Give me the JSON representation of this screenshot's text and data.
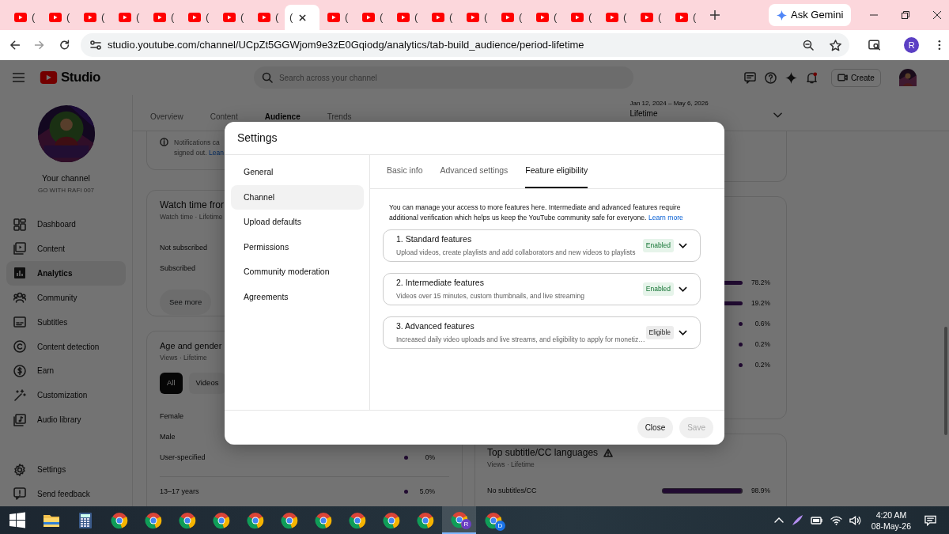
{
  "browser": {
    "tabs": [
      {
        "label": "(",
        "selected": false
      },
      {
        "label": "(",
        "selected": false
      },
      {
        "label": "(",
        "selected": false
      },
      {
        "label": "(",
        "selected": false
      },
      {
        "label": "(",
        "selected": false
      },
      {
        "label": "(",
        "selected": false
      },
      {
        "label": "(",
        "selected": false
      },
      {
        "label": "(",
        "selected": false
      },
      {
        "label": "(",
        "selected": true
      },
      {
        "label": "(",
        "selected": false
      },
      {
        "label": "(",
        "selected": false
      },
      {
        "label": "(",
        "selected": false
      },
      {
        "label": "(",
        "selected": false
      },
      {
        "label": "(",
        "selected": false
      },
      {
        "label": "(",
        "selected": false
      },
      {
        "label": "(",
        "selected": false
      },
      {
        "label": "(",
        "selected": false
      },
      {
        "label": "(",
        "selected": false
      },
      {
        "label": "(",
        "selected": false
      },
      {
        "label": "(",
        "selected": false
      }
    ],
    "gemini": "Ask Gemini",
    "url": "studio.youtube.com/channel/UCpZt5GGWjom9e3zE0Gqiodg/analytics/tab-build_audience/period-lifetime",
    "profile": "R"
  },
  "header": {
    "logo": "Studio",
    "search_placeholder": "Search across your channel",
    "create": "Create"
  },
  "sidebar": {
    "channel_title": "Your channel",
    "channel_name": "GO WITH RAFI 007",
    "items": [
      {
        "label": "Dashboard",
        "selected": false
      },
      {
        "label": "Content",
        "selected": false
      },
      {
        "label": "Analytics",
        "selected": true
      },
      {
        "label": "Community",
        "selected": false
      },
      {
        "label": "Subtitles",
        "selected": false
      },
      {
        "label": "Content detection",
        "selected": false
      },
      {
        "label": "Earn",
        "selected": false
      },
      {
        "label": "Customization",
        "selected": false
      },
      {
        "label": "Audio library",
        "selected": false
      }
    ],
    "footer_items": [
      {
        "label": "Settings"
      },
      {
        "label": "Send feedback"
      }
    ]
  },
  "analytics": {
    "tabs": [
      {
        "label": "Overview",
        "selected": false
      },
      {
        "label": "Content",
        "selected": false
      },
      {
        "label": "Audience",
        "selected": true
      },
      {
        "label": "Trends",
        "selected": false
      }
    ],
    "date_range": "Jan 12, 2024 – May 6, 2026",
    "period": "Lifetime",
    "notice": {
      "line1": "Notifications ca",
      "line2": "signed out.",
      "link": "Lean"
    },
    "watch_time": {
      "title": "Watch time fror",
      "subtitle": "Watch time · Lifetime",
      "rows": [
        "Not subscribed",
        "Subscribed"
      ],
      "button": "See more"
    },
    "age_gender": {
      "title": "Age and gender",
      "subtitle": "Views · Lifetime",
      "chips": [
        {
          "label": "All",
          "selected": true
        },
        {
          "label": "Videos",
          "selected": false
        }
      ],
      "rows": [
        {
          "label": "Female"
        },
        {
          "label": "Male"
        },
        {
          "label": "User-specified",
          "value": "0%"
        }
      ],
      "age_rows": [
        {
          "label": "13–17 years",
          "value": "5.0%"
        }
      ]
    },
    "right_rows": [
      {
        "kind": "bar",
        "value": "78.2%"
      },
      {
        "kind": "bar",
        "value": "19.2%"
      },
      {
        "kind": "dot",
        "value": "0.6%"
      },
      {
        "kind": "dot",
        "value": "0.2%"
      },
      {
        "kind": "dot",
        "value": "0.2%"
      }
    ],
    "subtitles": {
      "title": "Top subtitle/CC languages",
      "subtitle": "Views · Lifetime",
      "rows": [
        {
          "label": "No subtitles/CC",
          "value": "98.9%",
          "level": 0.989
        }
      ]
    }
  },
  "modal": {
    "title": "Settings",
    "nav": [
      {
        "label": "General",
        "selected": false
      },
      {
        "label": "Channel",
        "selected": true
      },
      {
        "label": "Upload defaults",
        "selected": false
      },
      {
        "label": "Permissions",
        "selected": false
      },
      {
        "label": "Community moderation",
        "selected": false
      },
      {
        "label": "Agreements",
        "selected": false
      }
    ],
    "tabs": [
      {
        "label": "Basic info",
        "selected": false
      },
      {
        "label": "Advanced settings",
        "selected": false
      },
      {
        "label": "Feature eligibility",
        "selected": true
      }
    ],
    "intro": "You can manage your access to more features here. Intermediate and advanced features require additional verification which helps us keep the YouTube community safe for everyone.",
    "intro_link": "Learn more",
    "features": [
      {
        "title": "1. Standard features",
        "description": "Upload videos, create playlists and add collaborators and new videos to playlists",
        "status": "Enabled",
        "kind": "enabled"
      },
      {
        "title": "2. Intermediate features",
        "description": "Videos over 15 minutes, custom thumbnails, and live streaming",
        "status": "Enabled",
        "kind": "enabled"
      },
      {
        "title": "3. Advanced features",
        "description": "Increased daily video uploads and live streams, and eligibility to apply for monetiz…",
        "status": "Eligible",
        "kind": "eligible"
      }
    ],
    "buttons": [
      {
        "label": "Close",
        "disabled": false
      },
      {
        "label": "Save",
        "disabled": true
      }
    ]
  },
  "taskbar": {
    "apps": [
      {
        "kind": "start",
        "selected": false
      },
      {
        "kind": "explorer",
        "selected": false
      },
      {
        "kind": "calculator",
        "selected": false
      },
      {
        "kind": "chrome",
        "selected": false
      },
      {
        "kind": "chrome",
        "selected": false
      },
      {
        "kind": "chrome",
        "selected": false
      },
      {
        "kind": "chrome",
        "selected": false
      },
      {
        "kind": "chrome",
        "selected": false
      },
      {
        "kind": "chrome",
        "selected": false
      },
      {
        "kind": "chrome",
        "selected": false
      },
      {
        "kind": "chrome",
        "selected": false
      },
      {
        "kind": "chrome",
        "selected": false
      },
      {
        "kind": "chrome",
        "selected": false
      },
      {
        "kind": "chrome",
        "badge": "R",
        "selected": true
      },
      {
        "kind": "chrome",
        "badge": "D",
        "selected": false
      }
    ],
    "time": "4:20 AM",
    "date": "08-May-26"
  }
}
